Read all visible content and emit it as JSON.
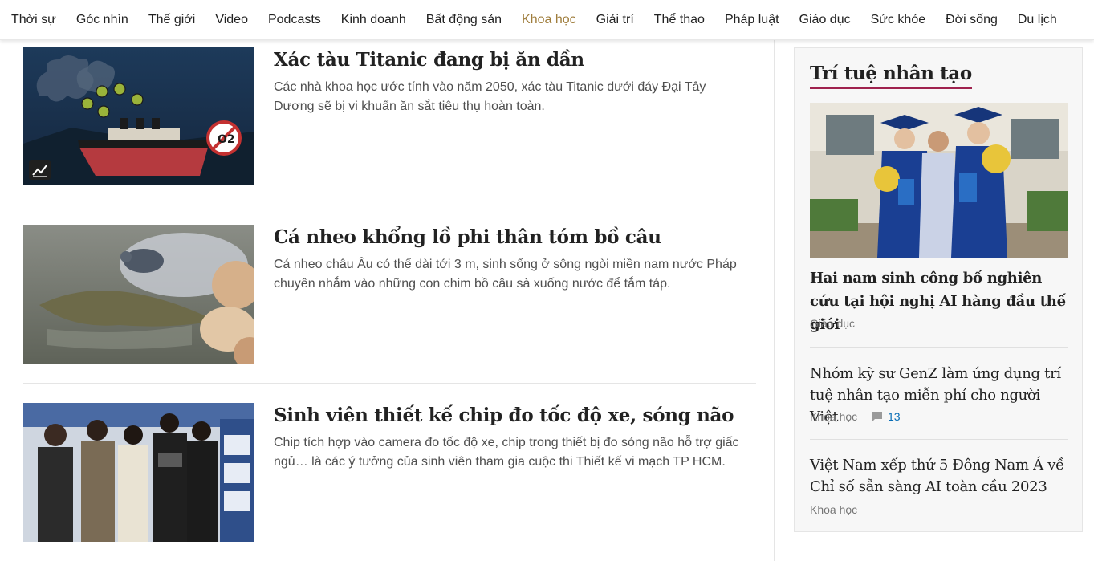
{
  "nav": {
    "items": [
      "Thời sự",
      "Góc nhìn",
      "Thế giới",
      "Video",
      "Podcasts",
      "Kinh doanh",
      "Bất động sản",
      "Khoa học",
      "Giải trí",
      "Thể thao",
      "Pháp luật",
      "Giáo dục",
      "Sức khỏe",
      "Đời sống",
      "Du lịch"
    ],
    "active": "Khoa học",
    "active_color": "#9f7d3c"
  },
  "articles": [
    {
      "title": "Xác tàu Titanic đang bị ăn dần",
      "description": "Các nhà khoa học ước tính vào năm 2050, xác tàu Titanic dưới đáy Đại Tây Dương sẽ bị vi khuẩn ăn sắt tiêu thụ hoàn toàn.",
      "thumbnail_icon": "infographic-icon",
      "thumbnail_badge": "O2"
    },
    {
      "title": "Cá nheo khổng lồ phi thân tóm bồ câu",
      "description": "Cá nheo châu Âu có thể dài tới 3 m, sinh sống ở sông ngòi miền nam nước Pháp chuyên nhắm vào những con chim bồ câu sà xuống nước để tắm táp."
    },
    {
      "title": "Sinh viên thiết kế chip đo tốc độ xe, sóng não",
      "description": "Chip tích hợp vào camera đo tốc độ xe, chip trong thiết bị đo sóng não hỗ trợ giấc ngủ… là các ý tưởng của sinh viên tham gia cuộc thi Thiết kế vi mạch TP HCM."
    }
  ],
  "sidebar": {
    "heading": "Trí tuệ nhân tạo",
    "heading_underline_color": "#9f224e",
    "items": [
      {
        "title": "Hai nam sinh công bố nghiên cứu tại hội nghị AI hàng đầu thế giới",
        "category": "Giáo dục"
      },
      {
        "title": "Nhóm kỹ sư GenZ làm ứng dụng trí tuệ nhân tạo miễn phí cho người Việt",
        "category": "Khoa học",
        "comments": "13"
      },
      {
        "title": "Việt Nam xếp thứ 5 Đông Nam Á về Chỉ số sẵn sàng AI toàn cầu 2023",
        "category": "Khoa học"
      }
    ]
  }
}
